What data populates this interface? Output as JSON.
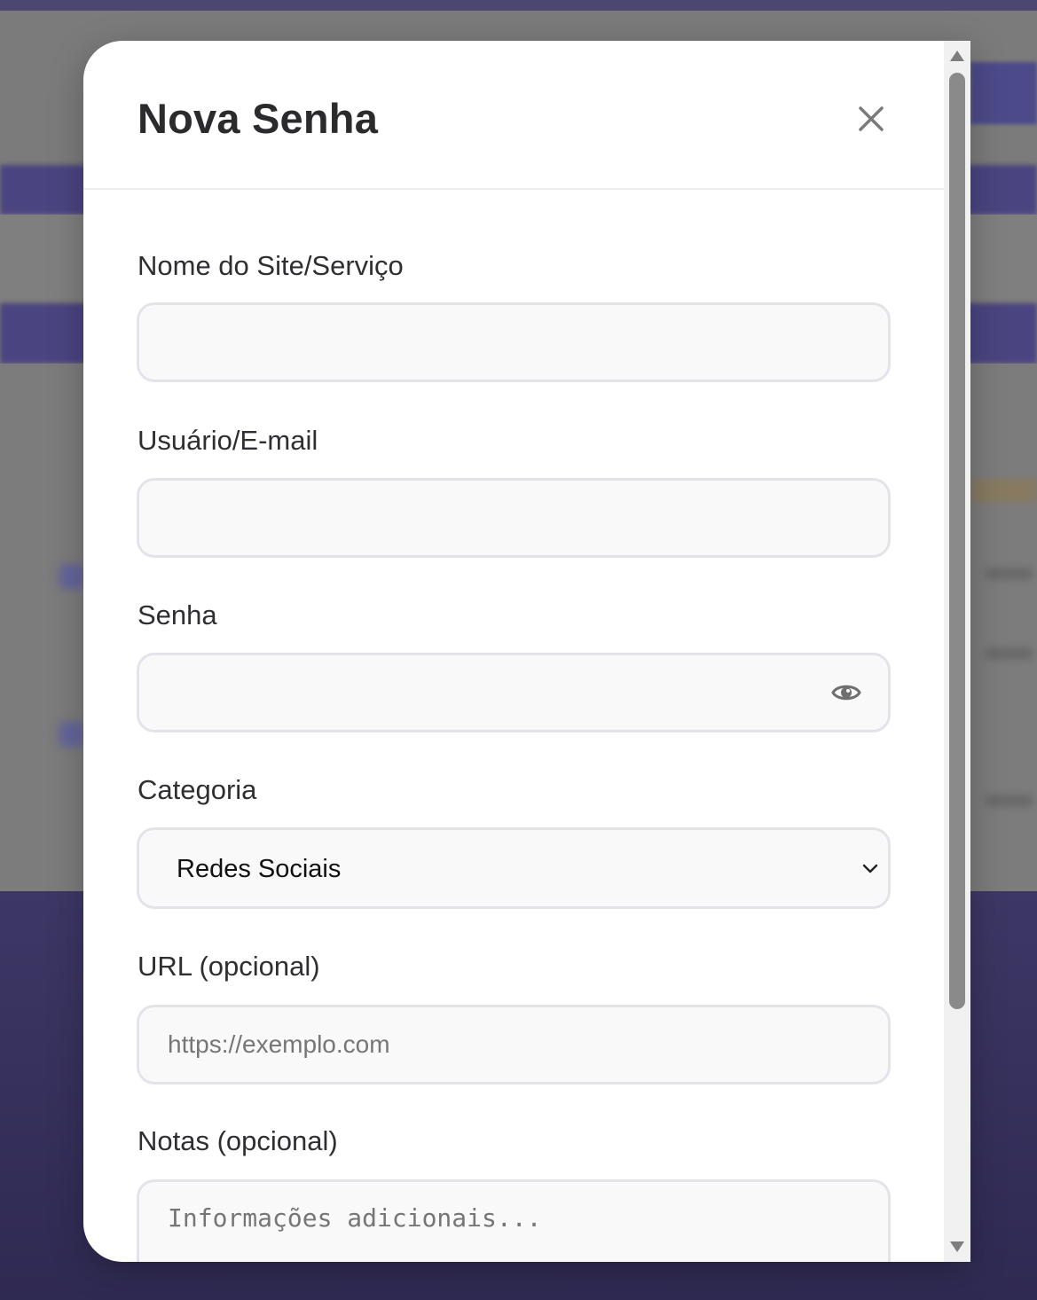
{
  "modal": {
    "title": "Nova Senha",
    "close_icon": "close-icon"
  },
  "form": {
    "site": {
      "label": "Nome do Site/Serviço",
      "value": "",
      "placeholder": ""
    },
    "user": {
      "label": "Usuário/E-mail",
      "value": "",
      "placeholder": ""
    },
    "password": {
      "label": "Senha",
      "value": "",
      "placeholder": "",
      "toggle_icon": "eye-icon"
    },
    "category": {
      "label": "Categoria",
      "selected": "Redes Sociais"
    },
    "url": {
      "label": "URL (opcional)",
      "value": "",
      "placeholder": "https://exemplo.com"
    },
    "notes": {
      "label": "Notas (opcional)",
      "value": "",
      "placeholder": "Informações adicionais..."
    }
  },
  "colors": {
    "overlay": "#7a7a7a",
    "background_accent": "#4a4480",
    "modal_bg": "#ffffff",
    "input_bg": "#f9f9fa",
    "input_border": "#e3e3ea",
    "title_text": "#2b2b2e"
  }
}
